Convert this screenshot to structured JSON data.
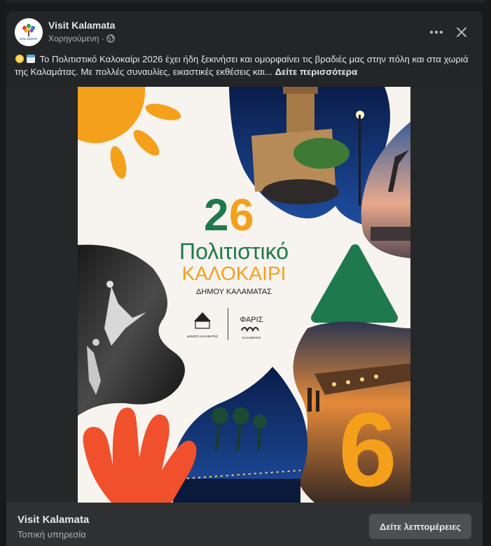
{
  "post": {
    "page_name": "Visit Kalamata",
    "sponsored_label": "Χορηγούμενη ·",
    "text": "Το Πολιτιστικό Καλοκαίρι 2026 έχει ήδη ξεκινήσει και ομορφαίνει τις βραδιές μας στην πόλη και στα χωριά της Καλαμάτας. Με πολλές συναυλίες, εικαστικές εκθέσεις και...",
    "see_more": "Δείτε περισσότερα",
    "icons": [
      "sun-emoji-icon",
      "calendar-emoji-icon",
      "globe-icon",
      "more-options-icon",
      "close-icon"
    ]
  },
  "poster": {
    "logo_small_text": "KALAMATA",
    "year_digits": "26",
    "title_line1": "Πολιτιστικό",
    "title_line2": "ΚΑΛΟΚΑΙΡΙ",
    "subtitle": "ΔΗΜΟΥ ΚΑΛΑΜΑΤΑΣ",
    "logo1_caption": "ΔΗΜΟΣ ΚΑΛΑΜΑΤΑΣ",
    "logo2_title": "ΦΑΡΙΣ",
    "logo2_caption": "ΚΑΛΑΜΑΤΑΣ",
    "big_digit": "6",
    "colors": {
      "orange": "#f5a01a",
      "green": "#1e7a4c",
      "red": "#f0502c",
      "cream": "#f7f3ee"
    }
  },
  "footer": {
    "title": "Visit Kalamata",
    "subtitle": "Τοπική υπηρεσία",
    "cta_label": "Δείτε λεπτομέρειες"
  }
}
